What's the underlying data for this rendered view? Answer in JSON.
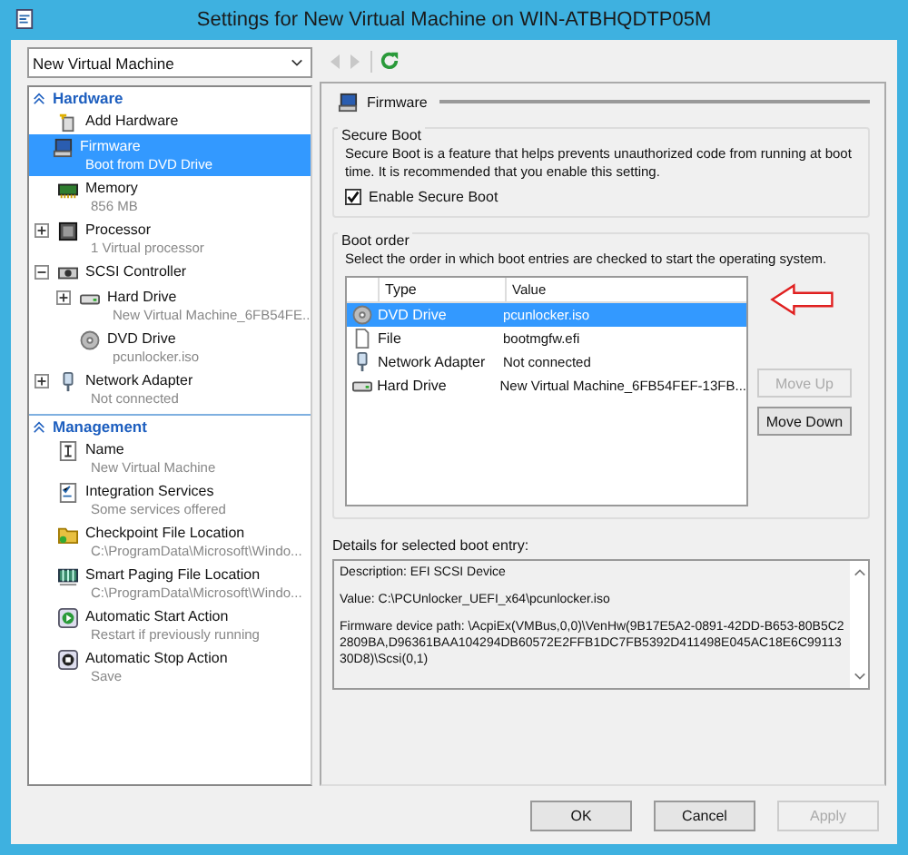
{
  "window": {
    "title": "Settings for New Virtual Machine on WIN-ATBHQDTP05M"
  },
  "vm_selector": {
    "value": "New Virtual Machine"
  },
  "toolbar": {
    "back_disabled": true,
    "forward_disabled": true
  },
  "sidebar": {
    "sections": [
      {
        "title": "Hardware",
        "expanded": true,
        "items": [
          {
            "kind": "add",
            "label": "Add Hardware",
            "selected": false
          },
          {
            "kind": "firmware",
            "label": "Firmware",
            "detail": "Boot from DVD Drive",
            "selected": true
          },
          {
            "kind": "memory",
            "label": "Memory",
            "detail": "856 MB",
            "selected": false
          },
          {
            "kind": "processor",
            "label": "Processor",
            "detail": "1 Virtual processor",
            "selected": false,
            "expanded": false
          },
          {
            "kind": "scsi",
            "label": "SCSI Controller",
            "selected": false,
            "expanded": true,
            "children": [
              {
                "kind": "harddrive",
                "label": "Hard Drive",
                "detail": "New Virtual Machine_6FB54FE...",
                "selected": false,
                "expanded": false
              },
              {
                "kind": "dvd",
                "label": "DVD Drive",
                "detail": "pcunlocker.iso",
                "selected": false
              }
            ]
          },
          {
            "kind": "network",
            "label": "Network Adapter",
            "detail": "Not connected",
            "selected": false,
            "expanded": false
          }
        ]
      },
      {
        "title": "Management",
        "expanded": true,
        "items": [
          {
            "kind": "name",
            "label": "Name",
            "detail": "New Virtual Machine",
            "selected": false
          },
          {
            "kind": "integration",
            "label": "Integration Services",
            "detail": "Some services offered",
            "selected": false
          },
          {
            "kind": "folder",
            "label": "Checkpoint File Location",
            "detail": "C:\\ProgramData\\Microsoft\\Windo...",
            "selected": false
          },
          {
            "kind": "paging",
            "label": "Smart Paging File Location",
            "detail": "C:\\ProgramData\\Microsoft\\Windo...",
            "selected": false
          },
          {
            "kind": "start",
            "label": "Automatic Start Action",
            "detail": "Restart if previously running",
            "selected": false
          },
          {
            "kind": "stop",
            "label": "Automatic Stop Action",
            "detail": "Save",
            "selected": false
          }
        ]
      }
    ]
  },
  "panel": {
    "title": "Firmware",
    "secure_boot": {
      "title": "Secure Boot",
      "text": "Secure Boot is a feature that helps prevents unauthorized code from running at boot time. It is recommended that you enable this setting.",
      "checkbox": {
        "label": "Enable Secure Boot",
        "checked": true
      }
    },
    "boot_order": {
      "title": "Boot order",
      "text": "Select the order in which boot entries are checked to start the operating system.",
      "columns": [
        "Type",
        "Value"
      ],
      "rows": [
        {
          "kind": "dvd",
          "type": "DVD Drive",
          "value": "pcunlocker.iso",
          "selected": true
        },
        {
          "kind": "file",
          "type": "File",
          "value": "bootmgfw.efi",
          "selected": false
        },
        {
          "kind": "network",
          "type": "Network Adapter",
          "value": "Not connected",
          "selected": false
        },
        {
          "kind": "harddrive",
          "type": "Hard Drive",
          "value": "New Virtual Machine_6FB54FEF-13FB...",
          "selected": false
        }
      ],
      "buttons": [
        {
          "label": "Move Up",
          "disabled": true
        },
        {
          "label": "Move Down",
          "disabled": false
        }
      ]
    },
    "details": {
      "label": "Details for selected boot entry:",
      "lines": [
        "Description: EFI SCSI Device",
        "Value: C:\\PCUnlocker_UEFI_x64\\pcunlocker.iso",
        "Firmware device path: \\AcpiEx(VMBus,0,0)\\VenHw(9B17E5A2-0891-42DD-B653-80B5C22809BA,D96361BAA104294DB60572E2FFB1DC7FB5392D411498E045AC18E6C9911330D8)\\Scsi(0,1)"
      ]
    }
  },
  "buttons": [
    {
      "label": "OK",
      "disabled": false
    },
    {
      "label": "Cancel",
      "disabled": false
    },
    {
      "label": "Apply",
      "disabled": true
    }
  ]
}
